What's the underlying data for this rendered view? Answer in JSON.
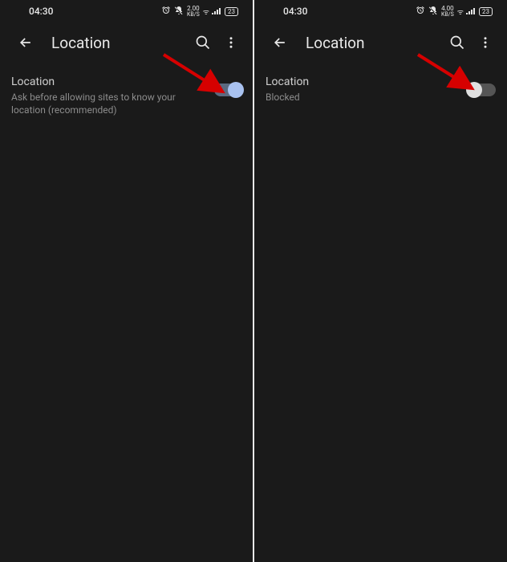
{
  "screens": [
    {
      "status": {
        "time": "04:30",
        "speed_value": "2.00",
        "speed_unit": "KB/S",
        "battery": "23"
      },
      "app_bar": {
        "title": "Location"
      },
      "setting": {
        "title": "Location",
        "desc": "Ask before allowing sites to know your location (recommended)"
      }
    },
    {
      "status": {
        "time": "04:30",
        "speed_value": "4.00",
        "speed_unit": "KB/S",
        "battery": "23"
      },
      "app_bar": {
        "title": "Location"
      },
      "setting": {
        "title": "Location",
        "desc": "Blocked"
      }
    }
  ]
}
